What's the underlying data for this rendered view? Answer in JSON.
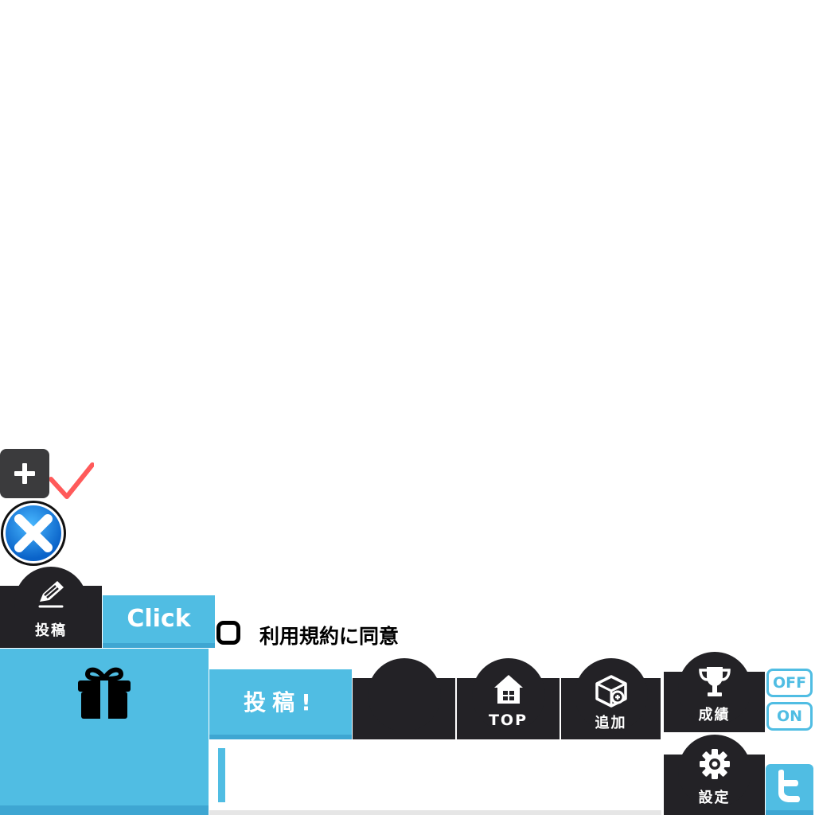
{
  "post_tab": {
    "label": "投稿"
  },
  "click_button": {
    "label": "Click"
  },
  "agreement": {
    "label": "利用規約に同意",
    "checked": false
  },
  "submit_button": {
    "label": "投稿!"
  },
  "nav": {
    "top_label": "TOP",
    "add_label": "追加",
    "score_label": "成績",
    "settings_label": "設定"
  },
  "toggles": {
    "off_label": "OFF",
    "on_label": "ON"
  },
  "colors": {
    "accent": "#50bde3",
    "accent_dark": "#3ea6d2",
    "tab_dark": "#232226",
    "check": "#ff5a5a"
  },
  "icons": {
    "plus": "plus-icon",
    "check": "checkmark-icon",
    "close": "close-icon",
    "pencil": "pencil-icon",
    "gift": "gift-icon",
    "home": "home-icon",
    "add": "add-box-icon",
    "trophy": "trophy-icon",
    "gear": "gear-icon",
    "twitter": "twitter-icon"
  }
}
